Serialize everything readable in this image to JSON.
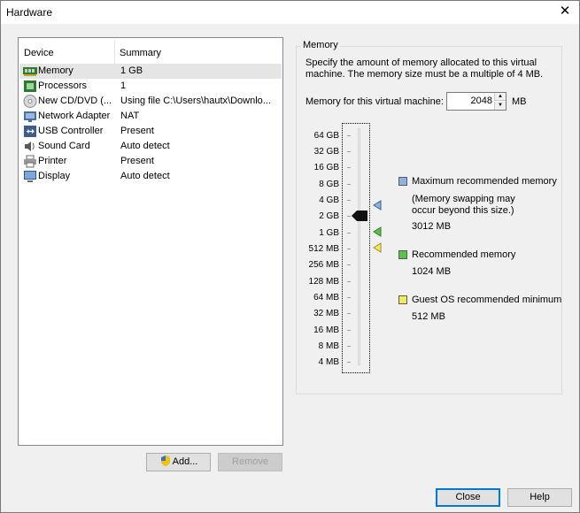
{
  "window": {
    "title": "Hardware"
  },
  "device_list": {
    "columns": [
      "Device",
      "Summary"
    ],
    "rows": [
      {
        "device": "Memory",
        "summary": "1 GB",
        "icon": "memory-icon"
      },
      {
        "device": "Processors",
        "summary": "1",
        "icon": "processor-icon"
      },
      {
        "device": "New CD/DVD (...",
        "summary": "Using file C:\\Users\\hautx\\Downlo...",
        "icon": "cd-dvd-icon"
      },
      {
        "device": "Network Adapter",
        "summary": "NAT",
        "icon": "network-adapter-icon"
      },
      {
        "device": "USB Controller",
        "summary": "Present",
        "icon": "usb-icon"
      },
      {
        "device": "Sound Card",
        "summary": "Auto detect",
        "icon": "sound-card-icon"
      },
      {
        "device": "Printer",
        "summary": "Present",
        "icon": "printer-icon"
      },
      {
        "device": "Display",
        "summary": "Auto detect",
        "icon": "display-icon"
      }
    ],
    "selected": "Memory"
  },
  "buttons": {
    "add": "Add...",
    "remove": "Remove",
    "close": "Close",
    "help": "Help"
  },
  "memory": {
    "group_label": "Memory",
    "description": "Specify the amount of memory allocated to this virtual machine. The memory size must be a multiple of 4 MB.",
    "field_label": "Memory for this virtual machine:",
    "value": "2048",
    "unit": "MB",
    "scale": [
      "64 GB",
      "32 GB",
      "16 GB",
      "8 GB",
      "4 GB",
      "2 GB",
      "1 GB",
      "512 MB",
      "256 MB",
      "128 MB",
      "64 MB",
      "32 MB",
      "16 MB",
      "8 MB",
      "4 MB"
    ],
    "legend": {
      "max_title": "Maximum recommended memory",
      "max_note1": "(Memory swapping may",
      "max_note2": "occur beyond this size.)",
      "max_value": "3012 MB",
      "rec_title": "Recommended memory",
      "rec_value": "1024 MB",
      "min_title": "Guest OS recommended minimum",
      "min_value": "512 MB"
    },
    "colors": {
      "max": "#8fb1dd",
      "rec": "#5cc24a",
      "min": "#f2ea5a"
    }
  }
}
